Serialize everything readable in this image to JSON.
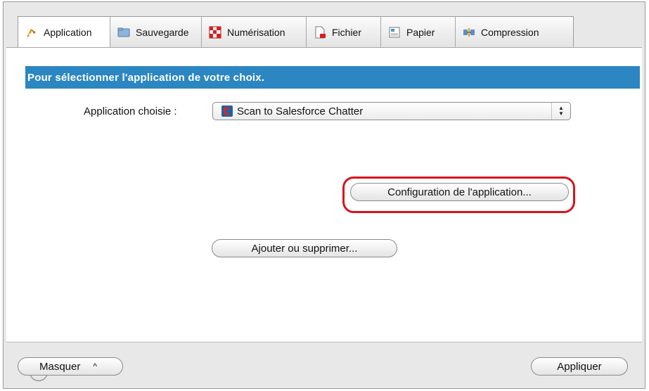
{
  "tabs": [
    {
      "label": "Application",
      "icon": "application-pen-icon",
      "active": true
    },
    {
      "label": "Sauvegarde",
      "icon": "folder-icon",
      "active": false
    },
    {
      "label": "Numérisation",
      "icon": "scan-checker-icon",
      "active": false
    },
    {
      "label": "Fichier",
      "icon": "file-pdf-icon",
      "active": false
    },
    {
      "label": "Papier",
      "icon": "paper-icon",
      "active": false
    },
    {
      "label": "Compression",
      "icon": "compression-icon",
      "active": false
    }
  ],
  "main": {
    "banner": "Pour sélectionner l'application de votre choix.",
    "app_label": "Application choisie :",
    "app_select": {
      "value": "Scan to Salesforce Chatter",
      "icon": "salesforce-chatter-icon"
    },
    "config_button": "Configuration de l'application...",
    "add_remove_button": "Ajouter ou supprimer..."
  },
  "footer": {
    "help": "?",
    "hide_button": "Masquer",
    "apply_button": "Appliquer"
  },
  "colors": {
    "banner": "#2b86c2",
    "highlight": "#d8141b",
    "logo": "#e2231a"
  }
}
